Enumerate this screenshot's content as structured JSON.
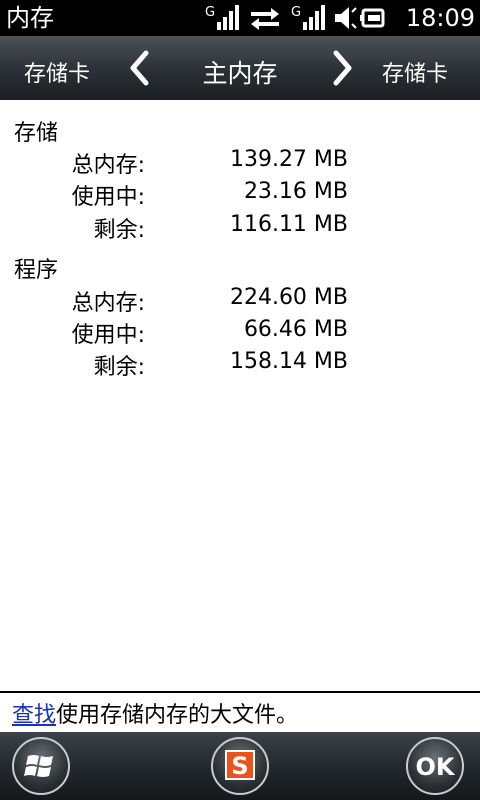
{
  "status_bar": {
    "app_title": "内存",
    "time": "18:09",
    "icons": [
      "signal-g-icon",
      "data-transfer-icon",
      "signal-g-icon",
      "speaker-icon",
      "battery-charging-icon"
    ]
  },
  "pivot": {
    "left_label": "存储卡",
    "center_label": "主内存",
    "right_label": "存储卡"
  },
  "sections": [
    {
      "title": "存储",
      "rows": [
        {
          "label": "总内存:",
          "value": "139.27 MB"
        },
        {
          "label": "使用中:",
          "value": "23.16 MB"
        },
        {
          "label": "剩余:",
          "value": "116.11 MB"
        }
      ]
    },
    {
      "title": "程序",
      "rows": [
        {
          "label": "总内存:",
          "value": "224.60 MB"
        },
        {
          "label": "使用中:",
          "value": "66.46 MB"
        },
        {
          "label": "剩余:",
          "value": "158.14 MB"
        }
      ]
    }
  ],
  "footer": {
    "link_text": "查找",
    "link_suffix": "使用存储内存的大文件。"
  },
  "softkeys": {
    "ok_label": "OK"
  }
}
